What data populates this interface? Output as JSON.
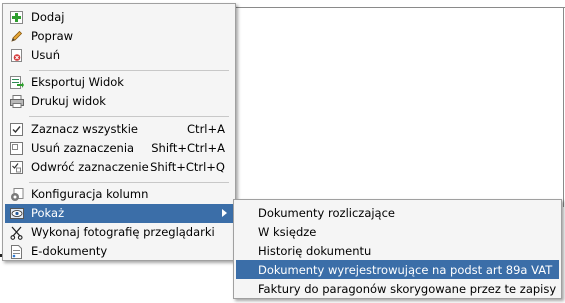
{
  "menu": {
    "items": [
      {
        "label": "Dodaj",
        "icon": "add-icon"
      },
      {
        "label": "Popraw",
        "icon": "pencil-icon"
      },
      {
        "label": "Usuń",
        "icon": "delete-icon"
      },
      {
        "label": "Eksportuj Widok",
        "icon": "export-icon"
      },
      {
        "label": "Drukuj widok",
        "icon": "printer-icon"
      },
      {
        "label": "Zaznacz wszystkie",
        "shortcut": "Ctrl+A",
        "icon": "check-all-icon"
      },
      {
        "label": "Usuń zaznaczenia",
        "shortcut": "Shift+Ctrl+A",
        "icon": "uncheck-icon"
      },
      {
        "label": "Odwróć zaznaczenie",
        "shortcut": "Shift+Ctrl+Q",
        "icon": "invert-selection-icon"
      },
      {
        "label": "Konfiguracja kolumn",
        "icon": "config-icon"
      },
      {
        "label": "Pokaż",
        "icon": "eye-icon"
      },
      {
        "label": "Wykonaj fotografię przeglądarki",
        "icon": "scissors-icon"
      },
      {
        "label": "E-dokumenty",
        "icon": "edocument-icon"
      }
    ]
  },
  "submenu": {
    "items": [
      {
        "label": "Dokumenty rozliczające"
      },
      {
        "label": "W księdze"
      },
      {
        "label": "Historię dokumentu"
      },
      {
        "label": "Dokumenty wyrejestrowujące na podst art 89a VAT"
      },
      {
        "label": "Faktury do paragonów skorygowane przez te zapisy"
      }
    ]
  },
  "colors": {
    "highlight": "#3b6ea8",
    "menu_bg": "#f5f5f5",
    "border": "#a0a0a0"
  }
}
